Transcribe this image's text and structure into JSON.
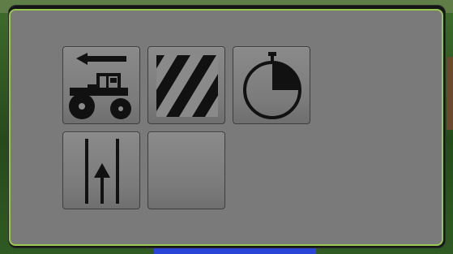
{
  "screen": {
    "background_colors": {
      "frame": "#151515",
      "panel": "#7a7a7a",
      "panel_border": "#98c84e",
      "tile": "#808080",
      "tile_border": "#3e3e3e",
      "accent_blue": "#2a44d8",
      "scene_green": "#3f6d2d"
    }
  },
  "dialog": {
    "tiles": [
      {
        "icon": "tractor-reverse-icon",
        "name": "tractor-reverse-tile"
      },
      {
        "icon": "diagonal-stripes-icon",
        "name": "stripes-tile"
      },
      {
        "icon": "stopwatch-icon",
        "name": "stopwatch-tile"
      },
      {
        "icon": "guidance-lines-icon",
        "name": "guidance-lines-tile"
      },
      {
        "icon": "",
        "name": "empty-tile"
      }
    ]
  }
}
